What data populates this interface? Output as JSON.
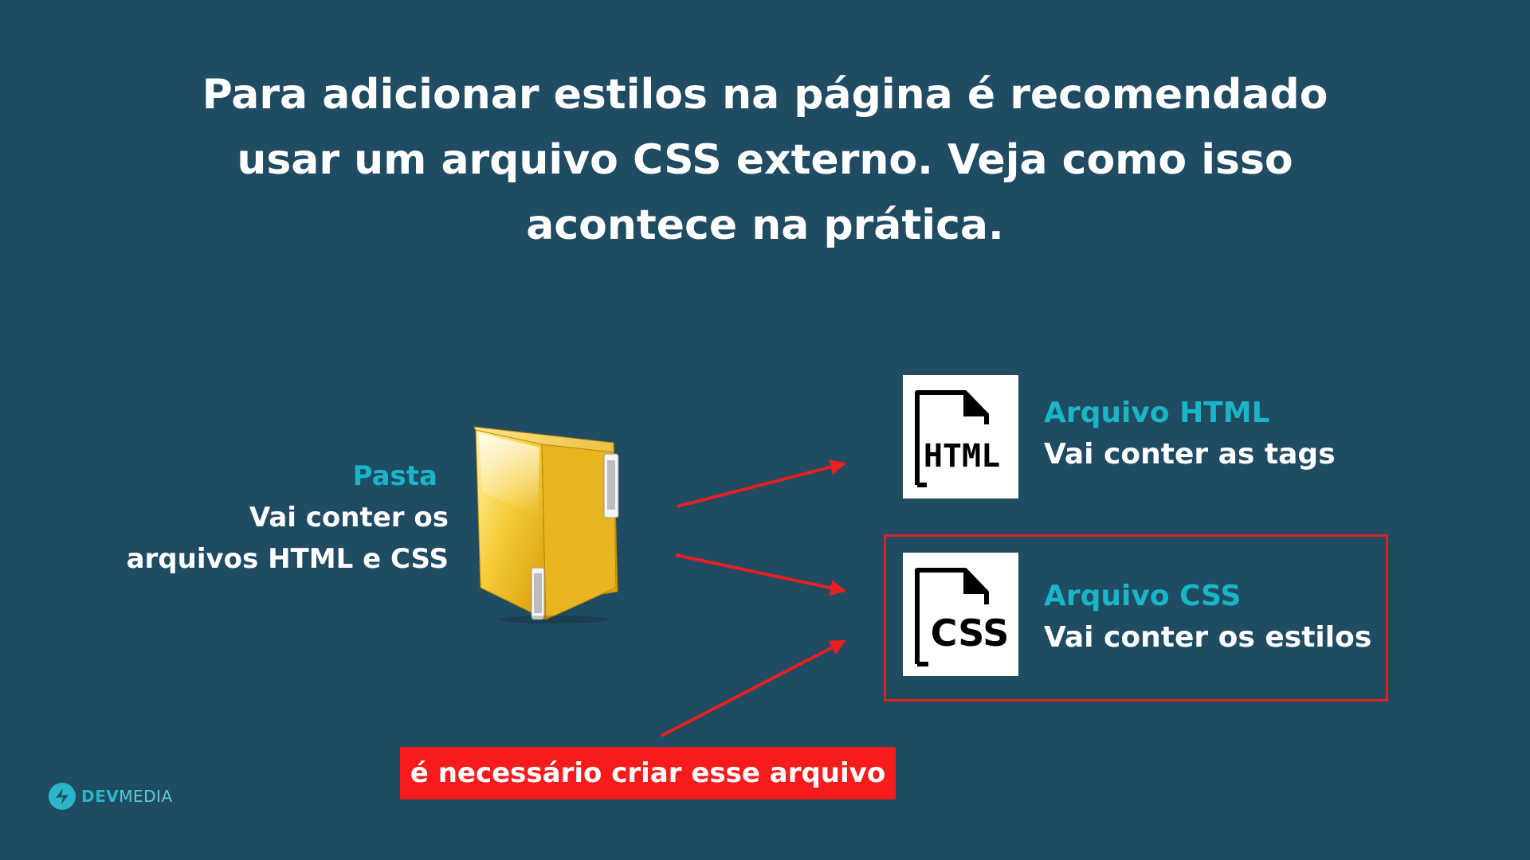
{
  "title": {
    "line1": "Para adicionar estilos na página é recomendado",
    "line2": "usar um arquivo CSS externo. Veja como isso",
    "line3": "acontece na prática."
  },
  "folder": {
    "label": "Pasta",
    "desc_line1": "Vai conter os",
    "desc_line2": "arquivos HTML e CSS",
    "icon": "folder-icon"
  },
  "files": [
    {
      "icon_text": "HTML",
      "title": "Arquivo HTML",
      "description": "Vai conter as tags",
      "icon": "html-file-icon"
    },
    {
      "icon_text": "CSS",
      "title": "Arquivo CSS",
      "description": "Vai conter os estilos",
      "icon": "css-file-icon"
    }
  ],
  "note": {
    "text": "é necessário criar esse arquivo"
  },
  "brand": {
    "name_bold": "DEV",
    "name_light": "MEDIA"
  },
  "colors": {
    "background": "#1f4b63",
    "accent": "#19b6c8",
    "arrow": "#e82020",
    "note_bg": "#f81b1b"
  }
}
